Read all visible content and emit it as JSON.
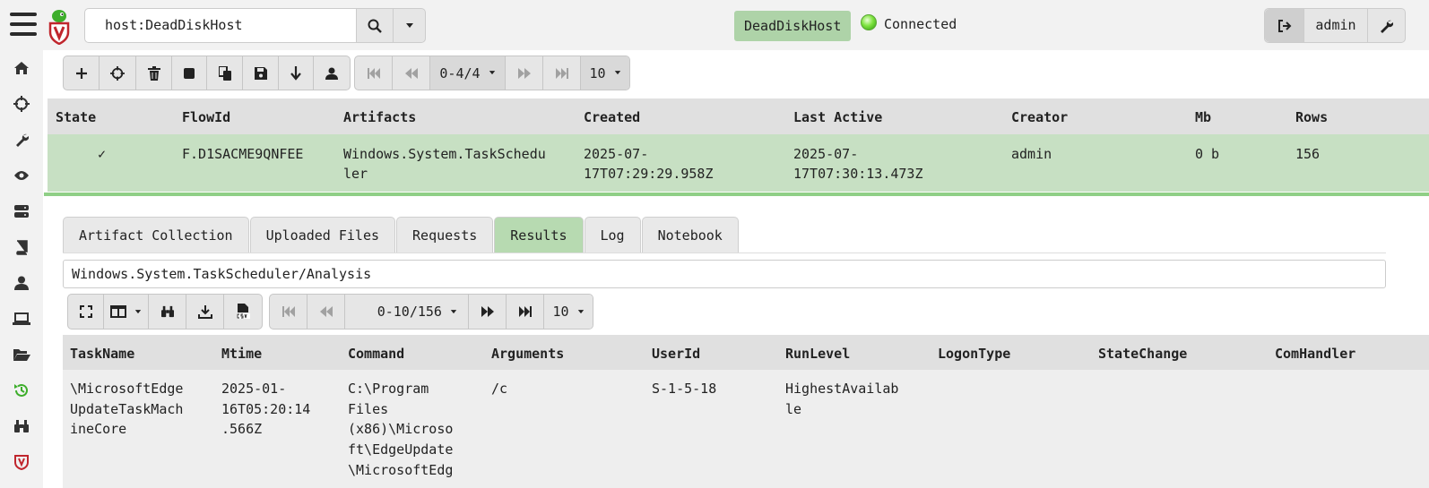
{
  "search": {
    "value": "host:DeadDiskHost"
  },
  "header": {
    "hostname": "DeadDiskHost",
    "status": "Connected",
    "user": "admin"
  },
  "flows_toolbar": {
    "page_range": "0-4/4",
    "page_size": "10"
  },
  "flows_table": {
    "headers": [
      "State",
      "FlowId",
      "Artifacts",
      "Created",
      "Last Active",
      "Creator",
      "Mb",
      "Rows"
    ],
    "row": {
      "state": "✓",
      "flow_id": "F.D1SACME9QNFEE",
      "artifact_l1": "Windows.System.TaskSchedu",
      "artifact_l2": "ler",
      "created_l1": "2025-07-",
      "created_l2": "17T07:29:29.958Z",
      "last_active_l1": "2025-07-",
      "last_active_l2": "17T07:30:13.473Z",
      "creator": "admin",
      "mb": "0 b",
      "rows": "156"
    }
  },
  "tabs": [
    {
      "label": "Artifact Collection"
    },
    {
      "label": "Uploaded Files"
    },
    {
      "label": "Requests"
    },
    {
      "label": "Results"
    },
    {
      "label": "Log"
    },
    {
      "label": "Notebook"
    }
  ],
  "results": {
    "path": "Windows.System.TaskScheduler/Analysis",
    "page_range": "0-10/156",
    "page_size": "10",
    "headers": [
      "TaskName",
      "Mtime",
      "Command",
      "Arguments",
      "UserId",
      "RunLevel",
      "LogonType",
      "StateChange",
      "ComHandler"
    ],
    "row": {
      "taskname": [
        "\\MicrosoftEdge",
        "UpdateTaskMach",
        "ineCore"
      ],
      "mtime": [
        "2025-01-",
        "16T05:20:14",
        ".566Z"
      ],
      "command": [
        "C:\\Program",
        "Files",
        "(x86)\\Microso",
        "ft\\EdgeUpdate",
        "\\MicrosoftEdg"
      ],
      "arguments": "/c",
      "userid": "S-1-5-18",
      "runlevel": [
        "HighestAvailab",
        "le"
      ]
    }
  },
  "colors": {
    "accent_green": "#b7dab1",
    "row_green": "#c7e0c3",
    "brand_red": "#c0262d",
    "logo_green": "#3dae2b"
  }
}
